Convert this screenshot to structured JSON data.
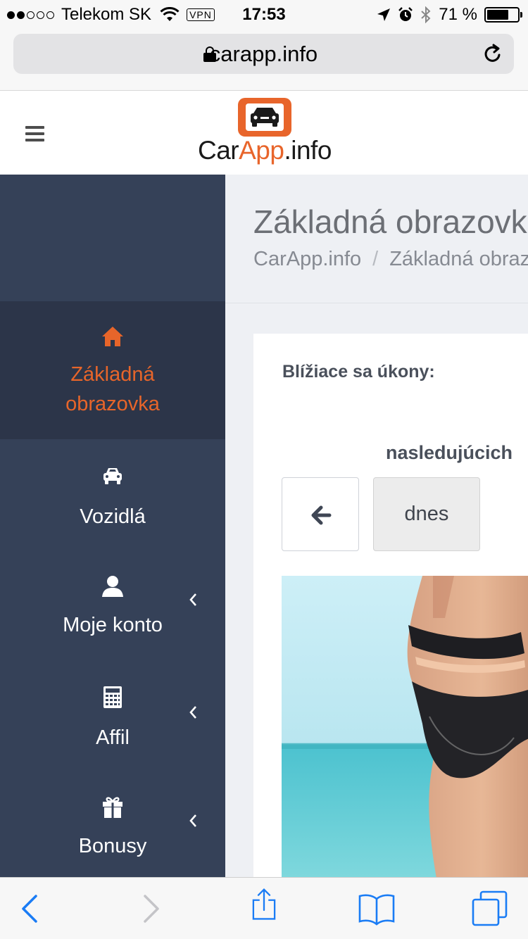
{
  "status_bar": {
    "carrier": "Telekom SK",
    "vpn": "VPN",
    "time": "17:53",
    "battery": "71 %",
    "battery_level": 0.71
  },
  "browser": {
    "url": "carapp.info"
  },
  "site": {
    "logo": {
      "text_dark_1": "Car",
      "text_accent": "App",
      "text_dark_2": ".info"
    }
  },
  "sidebar": {
    "items": [
      {
        "label_line1": "Základná",
        "label_line2": "obrazovka",
        "icon": "home-icon"
      },
      {
        "label": "Vozidlá",
        "icon": "car-icon"
      },
      {
        "label": "Moje konto",
        "icon": "user-icon"
      },
      {
        "label": "Affil",
        "icon": "calculator-icon"
      },
      {
        "label": "Bonusy",
        "icon": "gift-icon"
      }
    ]
  },
  "main": {
    "title": "Základná obrazovka",
    "breadcrumb": {
      "home": "CarApp.info",
      "separator": "/",
      "current": "Základná obrazovka"
    },
    "card": {
      "title": "Blížiace sa úkony:",
      "range_label": "nasledujúcich",
      "today_button": "dnes"
    }
  },
  "colors": {
    "accent": "#e7652a",
    "sidebar_bg": "#354158",
    "sidebar_active_bg": "#2c3549",
    "content_bg": "#eef0f4",
    "ios_blue": "#1a7cf5"
  }
}
